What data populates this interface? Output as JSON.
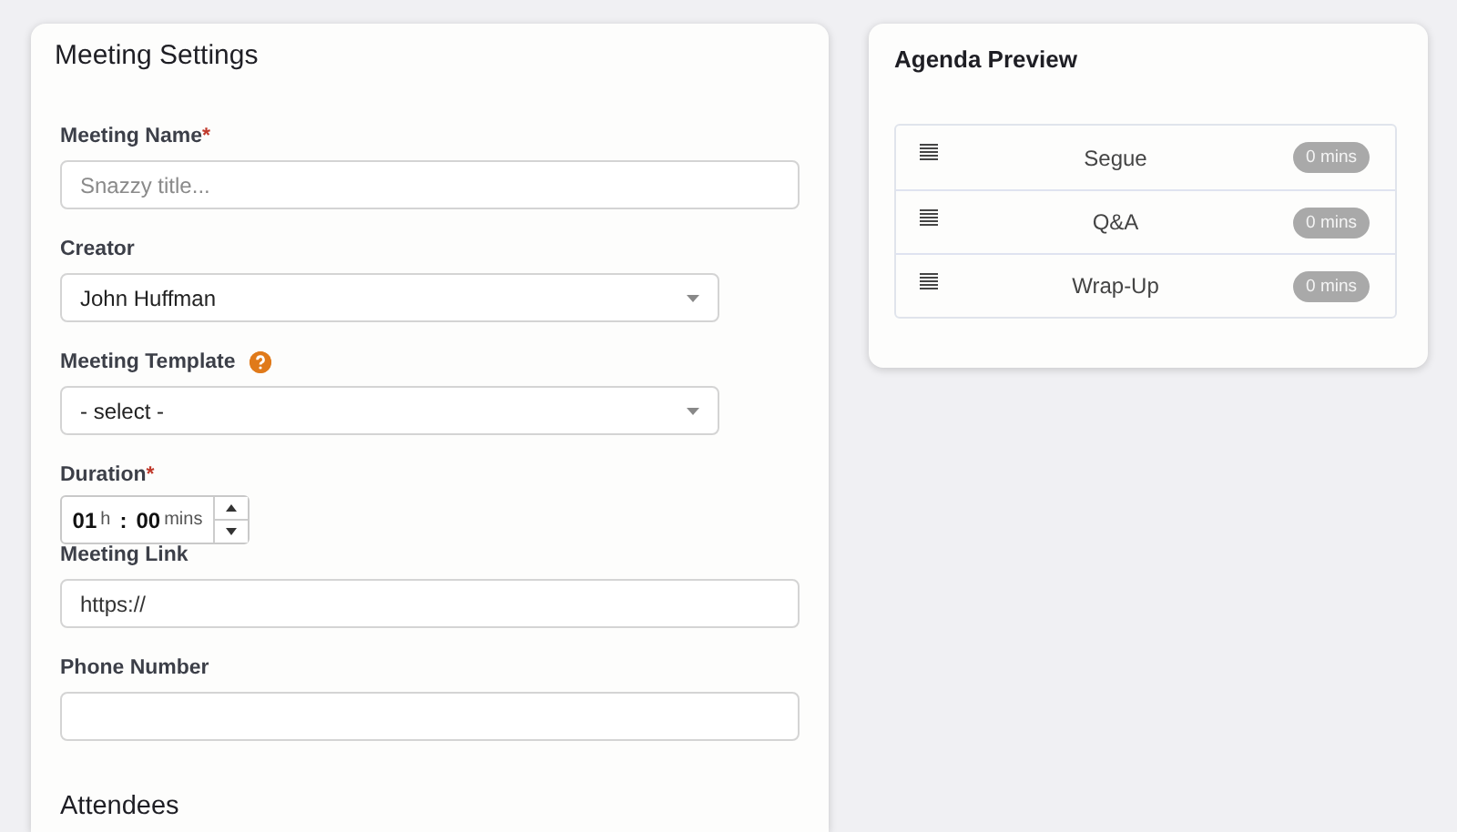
{
  "settings": {
    "title": "Meeting Settings",
    "fields": [
      {
        "kind": "text",
        "label": "Meeting Name",
        "required_mark": "*",
        "placeholder": "Snazzy title..."
      },
      {
        "kind": "select",
        "label": "Creator",
        "value": "John Huffman"
      },
      {
        "kind": "select",
        "label": "Meeting Template",
        "help": true,
        "value": "- select -"
      },
      {
        "kind": "duration",
        "label": "Duration",
        "required_mark": "*",
        "hours": "01",
        "hours_unit": "h",
        "separator": ":",
        "minutes": "00",
        "minutes_unit": "mins"
      },
      {
        "kind": "text",
        "label": "Meeting Link",
        "value": "https://"
      },
      {
        "kind": "text",
        "label": "Phone Number"
      }
    ],
    "next_section": "Attendees"
  },
  "agenda": {
    "title": "Agenda Preview",
    "items": [
      {
        "name": "Segue",
        "duration": "0 mins"
      },
      {
        "name": "Q&A",
        "duration": "0 mins"
      },
      {
        "name": "Wrap-Up",
        "duration": "0 mins"
      }
    ]
  }
}
